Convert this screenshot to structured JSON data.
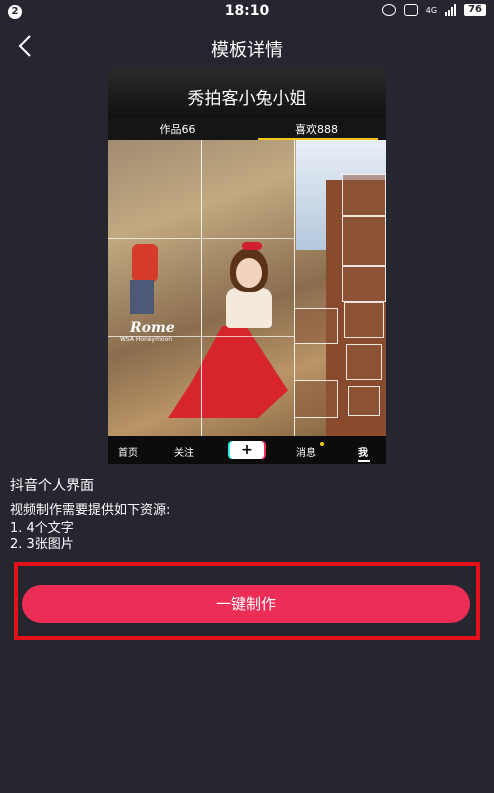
{
  "status_bar": {
    "notification_count": "2",
    "time": "18:10",
    "network_label": "4G",
    "battery": "76"
  },
  "header": {
    "title": "模板详情",
    "back_icon": "chevron-left-icon"
  },
  "preview": {
    "profile_name": "秀拍客小兔小姐",
    "tabs": [
      "作品66",
      "喜欢888"
    ],
    "photo_overlay_title": "Rome",
    "photo_overlay_subtitle": "WSA Honeymoon",
    "nav": {
      "home": "首页",
      "follow": "关注",
      "plus": "+",
      "messages": "消息",
      "me": "我"
    }
  },
  "template": {
    "name": "抖音个人界面",
    "requirements_title": "视频制作需要提供如下资源:",
    "requirements": [
      "1. 4个文字",
      "2. 3张图片"
    ]
  },
  "action": {
    "make_button": "一键制作"
  },
  "colors": {
    "background": "#262630",
    "accent": "#ec2d55",
    "highlight": "#e4101a",
    "tab_underline": "#f5c518"
  }
}
